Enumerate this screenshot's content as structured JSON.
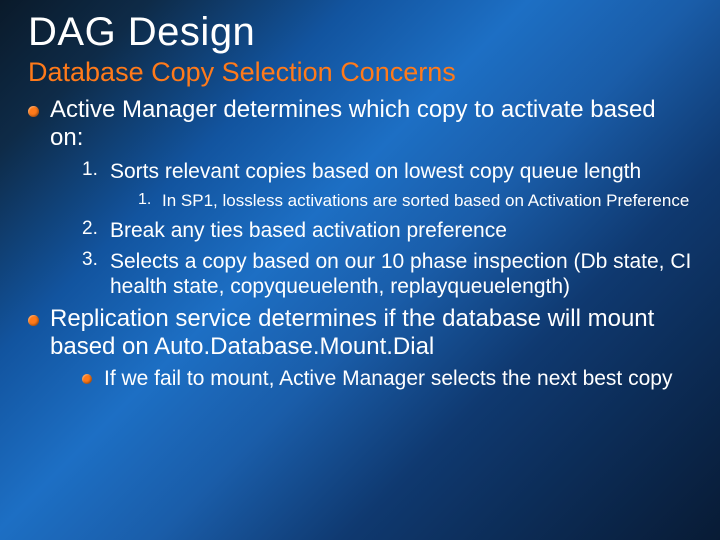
{
  "title": "DAG Design",
  "subtitle": "Database Copy Selection Concerns",
  "bullets": [
    {
      "text": "Active Manager determines which copy to activate based on:",
      "numbered": [
        {
          "n": "1.",
          "text": "Sorts relevant copies based on lowest copy queue length",
          "subnumbered": [
            {
              "n": "1.",
              "text": "In SP1, lossless activations are sorted based on Activation Preference"
            }
          ]
        },
        {
          "n": "2.",
          "text": "Break any ties based activation preference"
        },
        {
          "n": "3.",
          "text": "Selects a copy based on our 10 phase inspection (Db state, CI health state, copyqueuelenth, replayqueuelength)"
        }
      ]
    },
    {
      "text": "Replication service determines if the database will mount based on Auto.Database.Mount.Dial",
      "sub": [
        {
          "text": "If we fail to mount, Active Manager selects the next best copy"
        }
      ]
    }
  ]
}
